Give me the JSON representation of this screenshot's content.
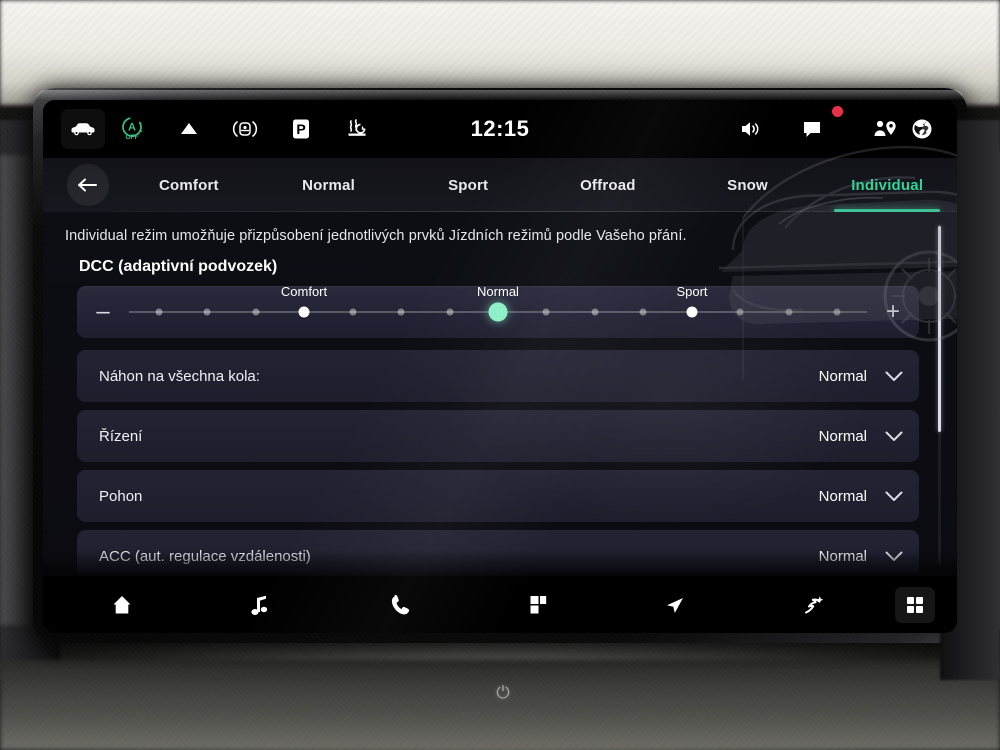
{
  "statusbar": {
    "icons_left": [
      {
        "name": "vehicle-icon",
        "title": "Vehicle"
      },
      {
        "name": "auto-start-stop-off-icon",
        "title": "Auto start/stop off",
        "label": "OFF"
      },
      {
        "name": "hill-descent-icon",
        "title": "Hill"
      },
      {
        "name": "lane-assist-icon",
        "title": "Lane assist"
      },
      {
        "name": "parking-icon",
        "title": "Parking",
        "label": "P"
      },
      {
        "name": "windshield-heating-icon",
        "title": "Windshield heating"
      }
    ],
    "clock": "12:15",
    "icons_right": [
      {
        "name": "volume-icon",
        "title": "Volume"
      },
      {
        "name": "message-icon",
        "title": "Messages",
        "badge": true
      },
      {
        "name": "user-location-icon",
        "title": "User profile"
      },
      {
        "name": "globe-icon",
        "title": "Online services"
      }
    ]
  },
  "tabbar": {
    "back_button": "back-arrow",
    "tabs": [
      {
        "label": "Comfort",
        "active": false
      },
      {
        "label": "Normal",
        "active": false
      },
      {
        "label": "Sport",
        "active": false
      },
      {
        "label": "Offroad",
        "active": false
      },
      {
        "label": "Snow",
        "active": false
      },
      {
        "label": "Individual",
        "active": true
      }
    ],
    "active_color": "#2fd49a"
  },
  "content": {
    "intro": "Individual režim umožňuje přizpůsobení jednotlivých prvků Jízdních režimů podle Vašeho přání.",
    "dcc": {
      "title": "DCC (adaptivní podvozek)",
      "minus_label": "–",
      "plus_label": "+",
      "steps": 15,
      "current_index": 7,
      "markers": [
        {
          "label": "Comfort",
          "index": 3
        },
        {
          "label": "Normal",
          "index": 7
        },
        {
          "label": "Sport",
          "index": 11
        }
      ]
    },
    "rows": [
      {
        "label": "Náhon na všechna kola:",
        "value": "Normal"
      },
      {
        "label": "Řízení",
        "value": "Normal"
      },
      {
        "label": "Pohon",
        "value": "Normal"
      },
      {
        "label": "ACC (aut. regulace vzdálenosti)",
        "value": "Normal"
      }
    ]
  },
  "bottombar": {
    "items": [
      {
        "name": "home-icon",
        "title": "Home"
      },
      {
        "name": "media-icon",
        "title": "Media"
      },
      {
        "name": "phone-icon",
        "title": "Phone"
      },
      {
        "name": "apps-icon",
        "title": "Apps"
      },
      {
        "name": "navigation-icon",
        "title": "Navigation"
      },
      {
        "name": "vehicle-settings-icon",
        "title": "Vehicle"
      },
      {
        "name": "grid-menu-icon",
        "title": "All apps"
      }
    ]
  },
  "device": {
    "power_icon": "⏻"
  }
}
